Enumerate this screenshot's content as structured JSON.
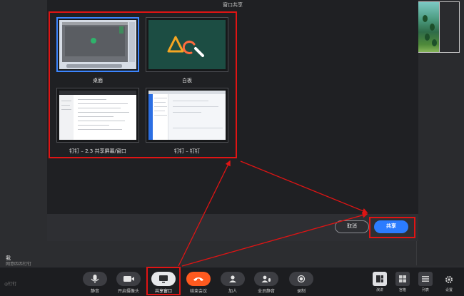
{
  "dialog": {
    "title": "窗口共享",
    "sources": [
      {
        "label": "桌面"
      },
      {
        "label": "白板"
      },
      {
        "label": "钉钉 – 2.3 共享屏幕/窗口"
      },
      {
        "label": "钉钉 – 钉钉"
      }
    ],
    "cancel_label": "取消",
    "share_label": "共享"
  },
  "participant": {
    "name": "我",
    "status": "网意匹匹钉钉"
  },
  "toolbar": {
    "logo": "◎钉钉",
    "buttons": [
      {
        "label": "静音"
      },
      {
        "label": "开启摄像头"
      },
      {
        "label": "共享窗口"
      },
      {
        "label": "结束会议"
      },
      {
        "label": "加人"
      },
      {
        "label": "全员静音"
      },
      {
        "label": "录制"
      }
    ],
    "layout": [
      {
        "label": "演讲"
      },
      {
        "label": "宫格"
      },
      {
        "label": "列表"
      },
      {
        "label": "设置"
      }
    ]
  },
  "colors": {
    "accent": "#2b7cff",
    "highlight": "#e01414",
    "end_call": "#ff5a1f"
  }
}
